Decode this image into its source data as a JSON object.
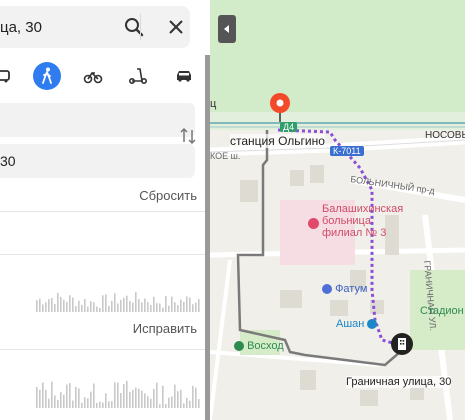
{
  "search": {
    "query": "ца, 30"
  },
  "route_form": {
    "from_value": "",
    "to_value": "30",
    "reset_label": "Сбросить"
  },
  "transport_modes": [
    "car-icon",
    "pedestrian-icon",
    "bicycle-icon",
    "scooter-icon",
    "taxi-icon"
  ],
  "active_mode": "pedestrian-icon",
  "routes": [
    {
      "fix_label": "Исправить"
    },
    {
      "fix_label": ""
    }
  ],
  "map": {
    "station": "станция Ольгино",
    "road_label_d4": "Д4",
    "road_label_k7011": "К-7011",
    "street_nosov": "НОСОВЫ",
    "street_bolnichny": "БОЛЬНИЧНЫЙ пр-д",
    "street_sh": "КОЕ ш.",
    "street_granichnaya": "ГРАНИЧНАЯ УЛ.",
    "hospital": "Балашихинская больница филиал № 3",
    "hospital_line1": "Балашихинская",
    "hospital_line2": "больница",
    "hospital_line3": "филиал № 3",
    "fatum": "Фатум",
    "ashan": "Ашан",
    "stadium": "Стадион",
    "voshod": "Восход",
    "destination": "Граничная улица, 30",
    "station_short": "ц"
  },
  "colors": {
    "accent": "#2f7bf0",
    "walk_route": "#8a4fd6",
    "pin": "#f24a2b",
    "road_gray": "#7a7a7a"
  }
}
